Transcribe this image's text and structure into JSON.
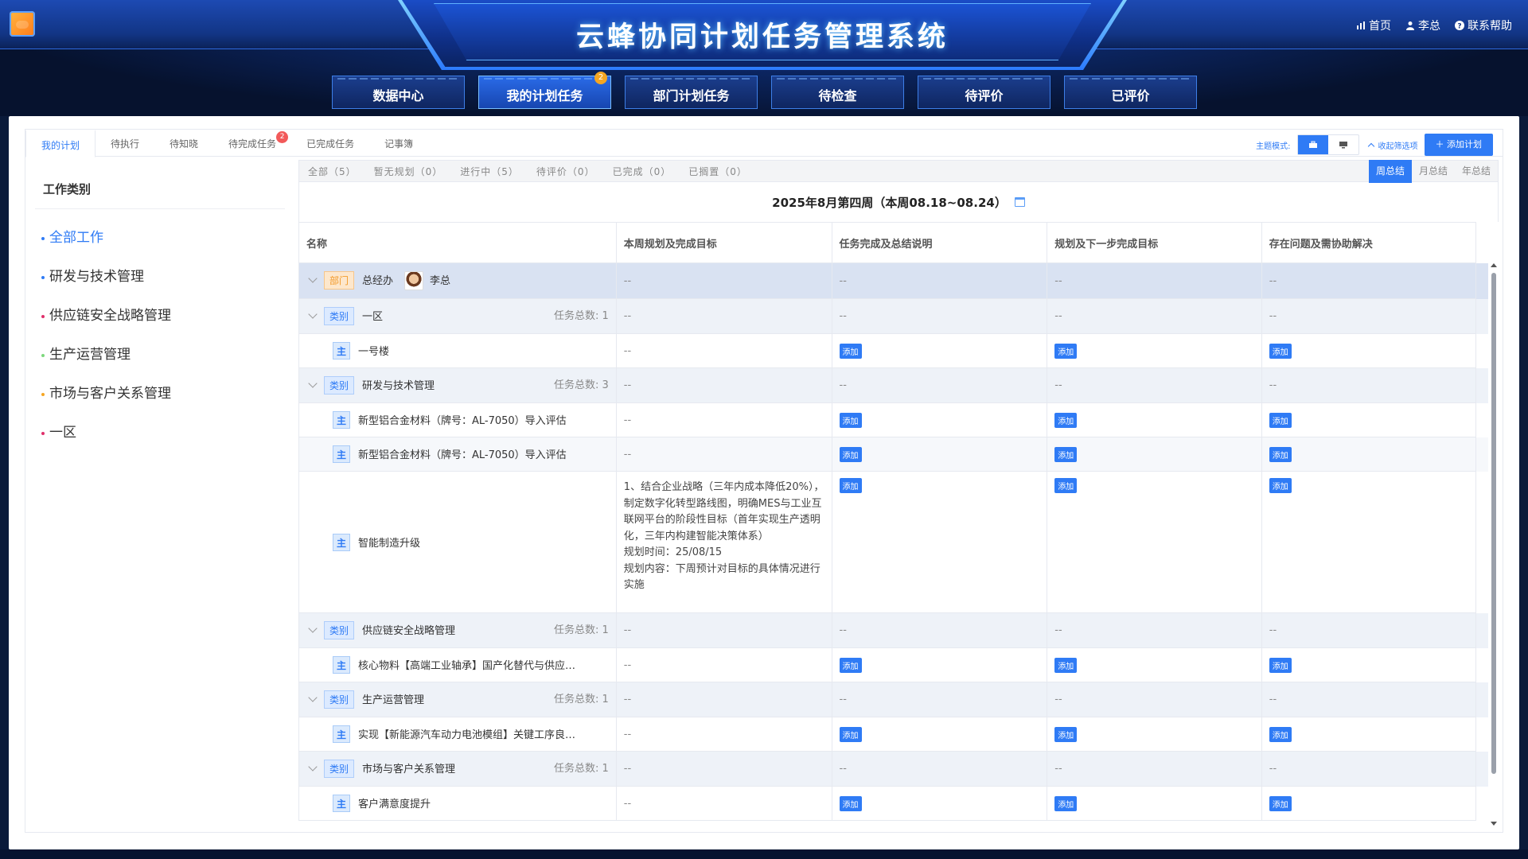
{
  "app": {
    "title": "云蜂协同计划任务管理系统",
    "top_links": [
      {
        "label": "首页",
        "icon": "bar-chart-icon"
      },
      {
        "label": "李总",
        "icon": "user-icon"
      },
      {
        "label": "联系帮助",
        "icon": "help-icon"
      }
    ]
  },
  "nav": {
    "tabs": [
      {
        "label": "数据中心"
      },
      {
        "label": "我的计划任务",
        "active": true,
        "badge": "2"
      },
      {
        "label": "部门计划任务"
      },
      {
        "label": "待检查"
      },
      {
        "label": "待评价"
      },
      {
        "label": "已评价"
      }
    ]
  },
  "subtabs": [
    {
      "label": "我的计划",
      "active": true
    },
    {
      "label": "待执行"
    },
    {
      "label": "待知晓"
    },
    {
      "label": "待完成任务",
      "badge": "2"
    },
    {
      "label": "已完成任务"
    },
    {
      "label": "记事簿"
    }
  ],
  "toolbar": {
    "theme_label": "主题模式:",
    "collapse_label": "收起筛选项",
    "add_plan_label": "＋ 添加计划"
  },
  "sidebar": {
    "title": "工作类别",
    "items": [
      {
        "label": "全部工作",
        "color": "#2f7bf5",
        "active": true
      },
      {
        "label": "研发与技术管理",
        "color": "#2f7bf5"
      },
      {
        "label": "供应链安全战略管理",
        "color": "#e0306b"
      },
      {
        "label": "生产运营管理",
        "color": "#7dd87d"
      },
      {
        "label": "市场与客户关系管理",
        "color": "#f5a623"
      },
      {
        "label": "一区",
        "color": "#e0306b"
      }
    ]
  },
  "filters": [
    "全部（5）",
    "暂无规划（0）",
    "进行中（5）",
    "待评价（0）",
    "已完成（0）",
    "已搁置（0）"
  ],
  "periods": [
    {
      "label": "周总结",
      "active": true
    },
    {
      "label": "月总结"
    },
    {
      "label": "年总结"
    }
  ],
  "week_title": "2025年8月第四周（本周08.18~08.24）",
  "table": {
    "headers": [
      "名称",
      "本周规划及完成目标",
      "任务完成及总结说明",
      "规划及下一步完成目标",
      "存在问题及需协助解决"
    ],
    "dash": "--",
    "add_label": "添加",
    "dept": {
      "tag": "部门",
      "name": "总经办",
      "person": "李总"
    },
    "cat_tag": "类别",
    "main_tag": "主",
    "count_prefix": "任务总数: ",
    "rows": [
      {
        "type": "cat",
        "name": "一区",
        "count": "1"
      },
      {
        "type": "task",
        "name": "一号楼"
      },
      {
        "type": "cat",
        "name": "研发与技术管理",
        "count": "3"
      },
      {
        "type": "task",
        "name": "新型铝合金材料（牌号：AL-7050）导入评估"
      },
      {
        "type": "task",
        "name": "新型铝合金材料（牌号：AL-7050）导入评估",
        "alt": true
      },
      {
        "type": "task",
        "name": "智能制造升级",
        "plan": "1、结合企业战略（三年内成本降低20%），制定数字化转型路线图，明确MES与工业互联网平台的阶段性目标（首年实现生产透明化，三年内构建智能决策体系）\n规划时间：25/08/15\n规划内容：下周预计对目标的具体情况进行实施"
      },
      {
        "type": "cat",
        "name": "供应链安全战略管理",
        "count": "1"
      },
      {
        "type": "task",
        "name": "核心物料【高端工业轴承】国产化替代与供应…"
      },
      {
        "type": "cat",
        "name": "生产运营管理",
        "count": "1"
      },
      {
        "type": "task",
        "name": "实现【新能源汽车动力电池模组】关键工序良…"
      },
      {
        "type": "cat",
        "name": "市场与客户关系管理",
        "count": "1"
      },
      {
        "type": "task",
        "name": "客户满意度提升"
      }
    ]
  }
}
